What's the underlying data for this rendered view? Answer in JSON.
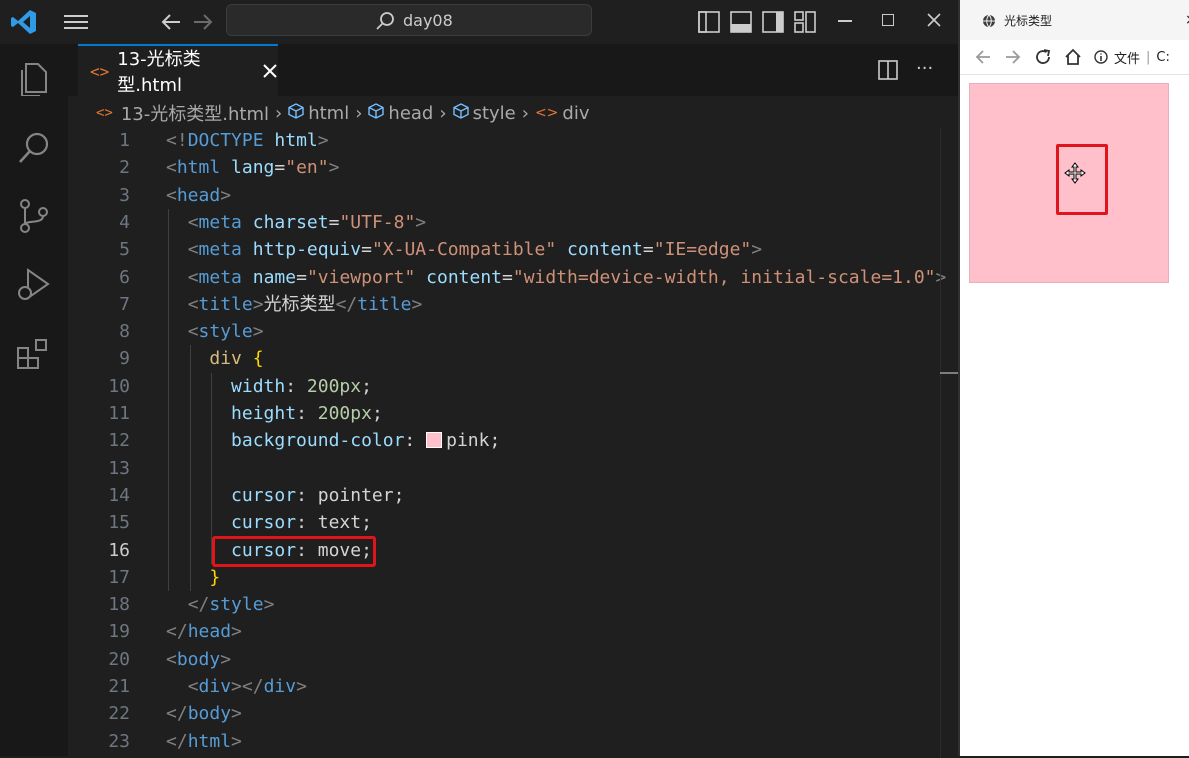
{
  "titlebar": {
    "search_text": "day08"
  },
  "tab": {
    "filename": "13-光标类型.html"
  },
  "breadcrumb": [
    "13-光标类型.html",
    "html",
    "head",
    "style",
    "div"
  ],
  "code": {
    "current_line": 16,
    "highlight_line": 16,
    "lines": [
      {
        "n": "1",
        "t": [
          [
            "punct",
            "<!"
          ],
          [
            "tag",
            "DOCTYPE"
          ],
          [
            "text",
            " "
          ],
          [
            "attr",
            "html"
          ],
          [
            "punct",
            ">"
          ]
        ]
      },
      {
        "n": "2",
        "t": [
          [
            "punct",
            "<"
          ],
          [
            "tag",
            "html"
          ],
          [
            "text",
            " "
          ],
          [
            "attr",
            "lang"
          ],
          [
            "text",
            "="
          ],
          [
            "str",
            "\"en\""
          ],
          [
            "punct",
            ">"
          ]
        ]
      },
      {
        "n": "3",
        "t": [
          [
            "punct",
            "<"
          ],
          [
            "tag",
            "head"
          ],
          [
            "punct",
            ">"
          ]
        ]
      },
      {
        "n": "4",
        "t": [
          [
            "text",
            "  "
          ],
          [
            "punct",
            "<"
          ],
          [
            "tag",
            "meta"
          ],
          [
            "text",
            " "
          ],
          [
            "attr",
            "charset"
          ],
          [
            "text",
            "="
          ],
          [
            "str",
            "\"UTF-8\""
          ],
          [
            "punct",
            ">"
          ]
        ]
      },
      {
        "n": "5",
        "t": [
          [
            "text",
            "  "
          ],
          [
            "punct",
            "<"
          ],
          [
            "tag",
            "meta"
          ],
          [
            "text",
            " "
          ],
          [
            "attr",
            "http-equiv"
          ],
          [
            "text",
            "="
          ],
          [
            "str",
            "\"X-UA-Compatible\""
          ],
          [
            "text",
            " "
          ],
          [
            "attr",
            "content"
          ],
          [
            "text",
            "="
          ],
          [
            "str",
            "\"IE=edge\""
          ],
          [
            "punct",
            ">"
          ]
        ]
      },
      {
        "n": "6",
        "t": [
          [
            "text",
            "  "
          ],
          [
            "punct",
            "<"
          ],
          [
            "tag",
            "meta"
          ],
          [
            "text",
            " "
          ],
          [
            "attr",
            "name"
          ],
          [
            "text",
            "="
          ],
          [
            "str",
            "\"viewport\""
          ],
          [
            "text",
            " "
          ],
          [
            "attr",
            "content"
          ],
          [
            "text",
            "="
          ],
          [
            "str",
            "\"width=device-width, initial-scale=1.0\""
          ],
          [
            "punct",
            ">"
          ]
        ]
      },
      {
        "n": "7",
        "t": [
          [
            "text",
            "  "
          ],
          [
            "punct",
            "<"
          ],
          [
            "tag",
            "title"
          ],
          [
            "punct",
            ">"
          ],
          [
            "text",
            "光标类型"
          ],
          [
            "punct",
            "</"
          ],
          [
            "tag",
            "title"
          ],
          [
            "punct",
            ">"
          ]
        ]
      },
      {
        "n": "8",
        "t": [
          [
            "text",
            "  "
          ],
          [
            "punct",
            "<"
          ],
          [
            "tag",
            "style"
          ],
          [
            "punct",
            ">"
          ]
        ]
      },
      {
        "n": "9",
        "t": [
          [
            "text",
            "    "
          ],
          [
            "sel",
            "div"
          ],
          [
            "text",
            " "
          ],
          [
            "brace",
            "{"
          ]
        ]
      },
      {
        "n": "10",
        "t": [
          [
            "text",
            "      "
          ],
          [
            "prop",
            "width"
          ],
          [
            "text",
            ": "
          ],
          [
            "val",
            "200px"
          ],
          [
            "text",
            ";"
          ]
        ]
      },
      {
        "n": "11",
        "t": [
          [
            "text",
            "      "
          ],
          [
            "prop",
            "height"
          ],
          [
            "text",
            ": "
          ],
          [
            "val",
            "200px"
          ],
          [
            "text",
            ";"
          ]
        ]
      },
      {
        "n": "12",
        "t": [
          [
            "text",
            "      "
          ],
          [
            "prop",
            "background-color"
          ],
          [
            "text",
            ": "
          ],
          [
            "swatch",
            "#ffc0cb"
          ],
          [
            "kw",
            "pink"
          ],
          [
            "text",
            ";"
          ]
        ]
      },
      {
        "n": "13",
        "t": []
      },
      {
        "n": "14",
        "t": [
          [
            "text",
            "      "
          ],
          [
            "prop",
            "cursor"
          ],
          [
            "text",
            ": "
          ],
          [
            "kw",
            "pointer"
          ],
          [
            "text",
            ";"
          ]
        ]
      },
      {
        "n": "15",
        "t": [
          [
            "text",
            "      "
          ],
          [
            "prop",
            "cursor"
          ],
          [
            "text",
            ": "
          ],
          [
            "kw",
            "text"
          ],
          [
            "text",
            ";"
          ]
        ]
      },
      {
        "n": "16",
        "t": [
          [
            "text",
            "      "
          ],
          [
            "prop",
            "cursor"
          ],
          [
            "text",
            ": "
          ],
          [
            "kw",
            "move"
          ],
          [
            "text",
            ";"
          ]
        ]
      },
      {
        "n": "17",
        "t": [
          [
            "text",
            "    "
          ],
          [
            "brace",
            "}"
          ]
        ]
      },
      {
        "n": "18",
        "t": [
          [
            "text",
            "  "
          ],
          [
            "punct",
            "</"
          ],
          [
            "tag",
            "style"
          ],
          [
            "punct",
            ">"
          ]
        ]
      },
      {
        "n": "19",
        "t": [
          [
            "punct",
            "</"
          ],
          [
            "tag",
            "head"
          ],
          [
            "punct",
            ">"
          ]
        ]
      },
      {
        "n": "20",
        "t": [
          [
            "punct",
            "<"
          ],
          [
            "tag",
            "body"
          ],
          [
            "punct",
            ">"
          ]
        ]
      },
      {
        "n": "21",
        "t": [
          [
            "text",
            "  "
          ],
          [
            "punct",
            "<"
          ],
          [
            "tag",
            "div"
          ],
          [
            "punct",
            "></"
          ],
          [
            "tag",
            "div"
          ],
          [
            "punct",
            ">"
          ]
        ]
      },
      {
        "n": "22",
        "t": [
          [
            "punct",
            "</"
          ],
          [
            "tag",
            "body"
          ],
          [
            "punct",
            ">"
          ]
        ]
      },
      {
        "n": "23",
        "t": [
          [
            "punct",
            "</"
          ],
          [
            "tag",
            "html"
          ],
          [
            "punct",
            ">"
          ]
        ]
      }
    ]
  },
  "browser": {
    "tab_title": "光标类型",
    "url_label": "文件",
    "url_tail": "C:",
    "page": {
      "box_color": "#ffc0cb",
      "box_cursor": "move"
    }
  },
  "colors": {
    "accent": "#0078d4",
    "highlight_red": "#e0151b"
  }
}
